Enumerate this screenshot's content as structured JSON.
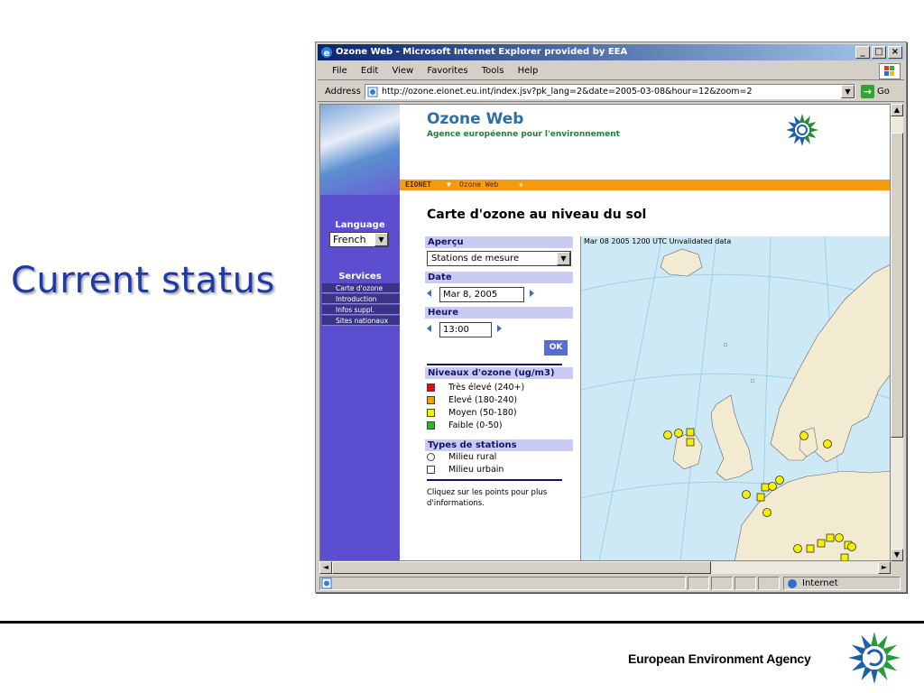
{
  "slide": {
    "title": "Current status",
    "footer_agency": "European Environment Agency"
  },
  "browser": {
    "window_title": "Ozone Web - Microsoft Internet Explorer provided by EEA",
    "menu": [
      "File",
      "Edit",
      "View",
      "Favorites",
      "Tools",
      "Help"
    ],
    "address_label": "Address",
    "url": "http://ozone.eionet.eu.int/index.jsv?pk_lang=2&date=2005-03-08&hour=12&zoom=2",
    "go_label": "Go",
    "status_zone": "Internet"
  },
  "page": {
    "site_title": "Ozone Web",
    "site_subtitle": "Agence européenne pour l'environnement",
    "breadcrumb": [
      "EIONET",
      "Ozone Web"
    ],
    "heading": "Carte d'ozone au niveau du sol",
    "language_label": "Language",
    "language_value": "French",
    "services_label": "Services",
    "services": [
      "Carte d'ozone",
      "Introduction",
      "Infos suppl.",
      "Sites nationaux"
    ],
    "overview_label": "Aperçu",
    "overview_value": "Stations de mesure",
    "date_label": "Date",
    "date_value": "Mar 8, 2005",
    "hour_label": "Heure",
    "hour_value": "13:00",
    "ok_label": "OK",
    "levels_title": "Niveaux d'ozone (ug/m3)",
    "levels": [
      {
        "label": "Très élevé (240+)",
        "color": "#e01010"
      },
      {
        "label": "Elevé (180-240)",
        "color": "#f5a000"
      },
      {
        "label": "Moyen (50-180)",
        "color": "#f5f000"
      },
      {
        "label": "Faible (0-50)",
        "color": "#20c020"
      }
    ],
    "station_types_title": "Types de stations",
    "station_types": [
      {
        "label": "Milieu rural",
        "shape": "circle"
      },
      {
        "label": "Milieu urbain",
        "shape": "square"
      }
    ],
    "note": "Cliquez sur les points pour plus d'informations.",
    "map_caption": "Mar 08 2005 1200 UTC   Unvalidated data"
  },
  "icons": {
    "browser": "ie-icon",
    "agency": "eea-logo-icon"
  }
}
